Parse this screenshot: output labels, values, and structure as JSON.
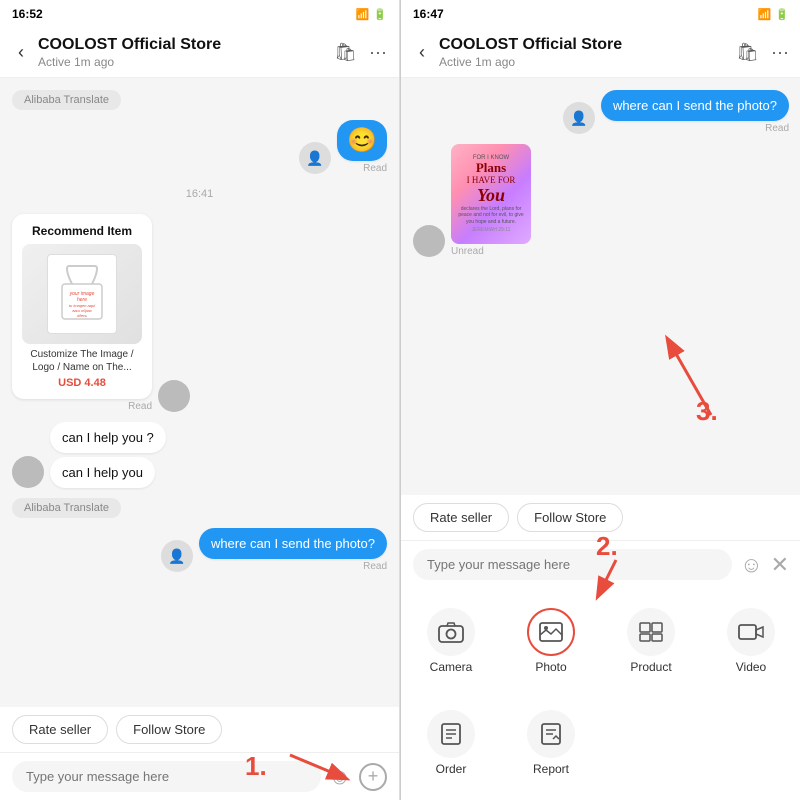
{
  "left": {
    "statusBar": {
      "time": "16:52",
      "icons": "📶🔋"
    },
    "header": {
      "back": "‹",
      "title": "COOLOST Official Store",
      "subtitle": "Active 1m ago",
      "icons": [
        "🛍",
        "•••"
      ]
    },
    "messages": [
      {
        "type": "translate-badge",
        "text": "Alibaba Translate"
      },
      {
        "type": "emoji-bubble",
        "emoji": "😊",
        "readLabel": "Read"
      },
      {
        "type": "timestamp",
        "text": "16:41"
      },
      {
        "type": "recommend-card",
        "title": "Recommend Item",
        "desc": "Customize The Image / Logo / Name on The...",
        "price": "USD 4.48",
        "readLabel": "Read"
      },
      {
        "type": "sys-msg",
        "lines": [
          "can I help you ?",
          "can I help you"
        ]
      },
      {
        "type": "translate-badge",
        "text": "Alibaba Translate"
      },
      {
        "type": "user-msg",
        "text": "where can I send the photo?",
        "readLabel": "Read"
      }
    ],
    "bottomActions": {
      "rateSeller": "Rate seller",
      "followStore": "Follow Store"
    },
    "inputPlaceholder": "Type your message here",
    "stepLabel": "1."
  },
  "right": {
    "statusBar": {
      "time": "16:47",
      "icons": "📶🔋"
    },
    "header": {
      "back": "‹",
      "title": "COOLOST Official Store",
      "subtitle": "Active 1m ago",
      "icons": [
        "🛍",
        "•••"
      ]
    },
    "messages": [
      {
        "type": "user-msg-right",
        "text": "where can I send the photo?",
        "readLabel": "Read"
      },
      {
        "type": "flower-img",
        "unread": "Unread"
      }
    ],
    "bottomActions": {
      "rateSeller": "Rate seller",
      "followStore": "Follow Store"
    },
    "inputPlaceholder": "Type your message here",
    "gridItems": [
      {
        "icon": "📷",
        "label": "Camera"
      },
      {
        "icon": "🖼",
        "label": "Photo",
        "highlighted": true
      },
      {
        "icon": "⊞",
        "label": "Product"
      },
      {
        "icon": "📹",
        "label": "Video"
      }
    ],
    "gridItems2": [
      {
        "icon": "📋",
        "label": "Order"
      },
      {
        "icon": "🚩",
        "label": "Report"
      }
    ],
    "step2Label": "2.",
    "step3Label": "3."
  },
  "icons": {
    "smile": "☺",
    "plus": "+",
    "back": "‹",
    "store": "🛍",
    "more": "···",
    "close": "✕"
  }
}
